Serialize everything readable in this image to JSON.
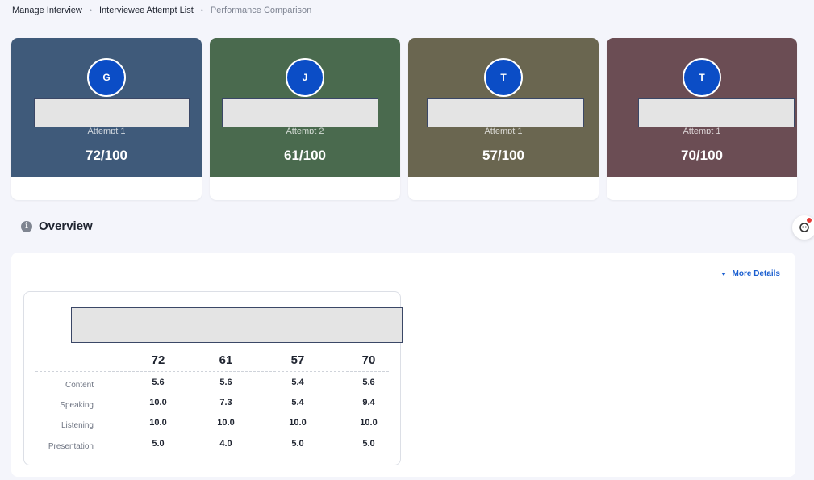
{
  "breadcrumb": {
    "items": [
      "Manage Interview",
      "Interviewee Attempt List",
      "Performance Comparison"
    ],
    "separator": "•"
  },
  "cards": [
    {
      "initial": "G",
      "attempt": "Attempt 1",
      "score": "72/100",
      "color": "#3f5a7a"
    },
    {
      "initial": "J",
      "attempt": "Attempt 2",
      "score": "61/100",
      "color": "#4a6a4e"
    },
    {
      "initial": "T",
      "attempt": "Attempt 1",
      "score": "57/100",
      "color": "#6a6650"
    },
    {
      "initial": "T",
      "attempt": "Attempt 1",
      "score": "70/100",
      "color": "#6b4d54"
    }
  ],
  "overview": {
    "title": "Overview",
    "info_icon": "info-icon",
    "more_details": "More Details"
  },
  "comparison": {
    "totals": [
      "72",
      "61",
      "57",
      "70"
    ],
    "rows": [
      {
        "label": "Content",
        "values": [
          "5.6",
          "5.6",
          "5.4",
          "5.6"
        ]
      },
      {
        "label": "Speaking",
        "values": [
          "10.0",
          "7.3",
          "5.4",
          "9.4"
        ]
      },
      {
        "label": "Listening",
        "values": [
          "10.0",
          "10.0",
          "10.0",
          "10.0"
        ]
      },
      {
        "label": "Presentation",
        "values": [
          "5.0",
          "4.0",
          "5.0",
          "5.0"
        ]
      }
    ]
  },
  "colors": {
    "avatar": "#0b4dc6",
    "accent_link": "#1b5fd0",
    "notification_dot": "#e53935"
  }
}
